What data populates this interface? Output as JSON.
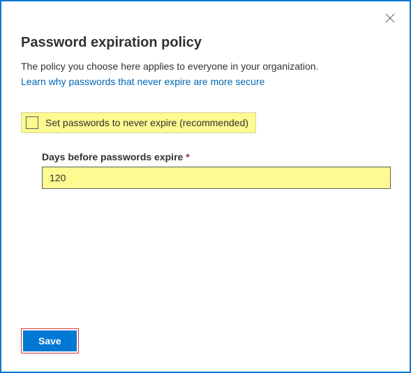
{
  "dialog": {
    "title": "Password expiration policy",
    "subtitle": "The policy you choose here applies to everyone in your organization.",
    "link_text": "Learn why passwords that never expire are more secure"
  },
  "form": {
    "checkbox_label": "Set passwords to never expire (recommended)",
    "days_label": "Days before passwords expire",
    "required_mark": "*",
    "days_value": "120"
  },
  "buttons": {
    "save": "Save"
  }
}
